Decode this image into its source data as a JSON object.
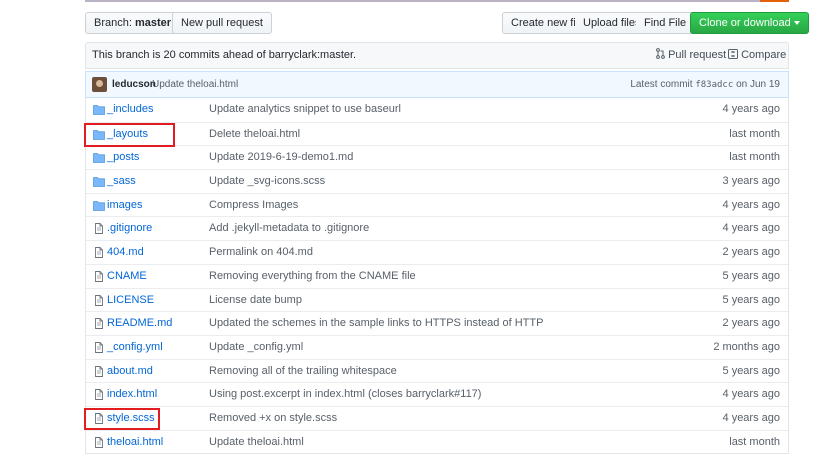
{
  "toolbar": {
    "branch_prefix": "Branch:",
    "branch_name": "master",
    "new_pr": "New pull request",
    "create_file": "Create new file",
    "upload_files": "Upload files",
    "find_file": "Find File",
    "clone": "Clone or download"
  },
  "branch_info": {
    "text": "This branch is 20 commits ahead of barryclark:master.",
    "pull_request": "Pull request",
    "compare": "Compare"
  },
  "commit": {
    "author": "leducson",
    "message": "Update theloai.html",
    "latest_label": "Latest commit",
    "sha": "f83adcc",
    "date": "on Jun 19"
  },
  "files": [
    {
      "type": "dir",
      "name": "_includes",
      "msg": "Update analytics snippet to use baseurl",
      "age": "4 years ago"
    },
    {
      "type": "dir",
      "name": "_layouts",
      "msg": "Delete theloai.html",
      "age": "last month"
    },
    {
      "type": "dir",
      "name": "_posts",
      "msg": "Update 2019-6-19-demo1.md",
      "age": "last month"
    },
    {
      "type": "dir",
      "name": "_sass",
      "msg": "Update _svg-icons.scss",
      "age": "3 years ago"
    },
    {
      "type": "dir",
      "name": "images",
      "msg": "Compress Images",
      "age": "4 years ago"
    },
    {
      "type": "file",
      "name": ".gitignore",
      "msg": "Add .jekyll-metadata to .gitignore",
      "age": "4 years ago"
    },
    {
      "type": "file",
      "name": "404.md",
      "msg": "Permalink on 404.md",
      "age": "2 years ago"
    },
    {
      "type": "file",
      "name": "CNAME",
      "msg": "Removing everything from the CNAME file",
      "age": "5 years ago"
    },
    {
      "type": "file",
      "name": "LICENSE",
      "msg": "License date bump",
      "age": "5 years ago"
    },
    {
      "type": "file",
      "name": "README.md",
      "msg": "Updated the schemes in the sample links to HTTPS instead of HTTP",
      "age": "2 years ago"
    },
    {
      "type": "file",
      "name": "_config.yml",
      "msg": "Update _config.yml",
      "age": "2 months ago"
    },
    {
      "type": "file",
      "name": "about.md",
      "msg": "Removing all of the trailing whitespace",
      "age": "5 years ago"
    },
    {
      "type": "file",
      "name": "index.html",
      "msg": "Using post.excerpt in index.html (closes barryclark#117)",
      "age": "4 years ago"
    },
    {
      "type": "file",
      "name": "style.scss",
      "msg": "Removed +x on style.scss",
      "age": "4 years ago"
    },
    {
      "type": "file",
      "name": "theloai.html",
      "msg": "Update theloai.html",
      "age": "last month"
    }
  ],
  "icons": {
    "dir": "folder-icon",
    "file": "file-icon"
  },
  "colors": {
    "link": "#0366d6",
    "highlight": "#e11d21",
    "green": "#28a745",
    "folder": "#79b8ff"
  }
}
